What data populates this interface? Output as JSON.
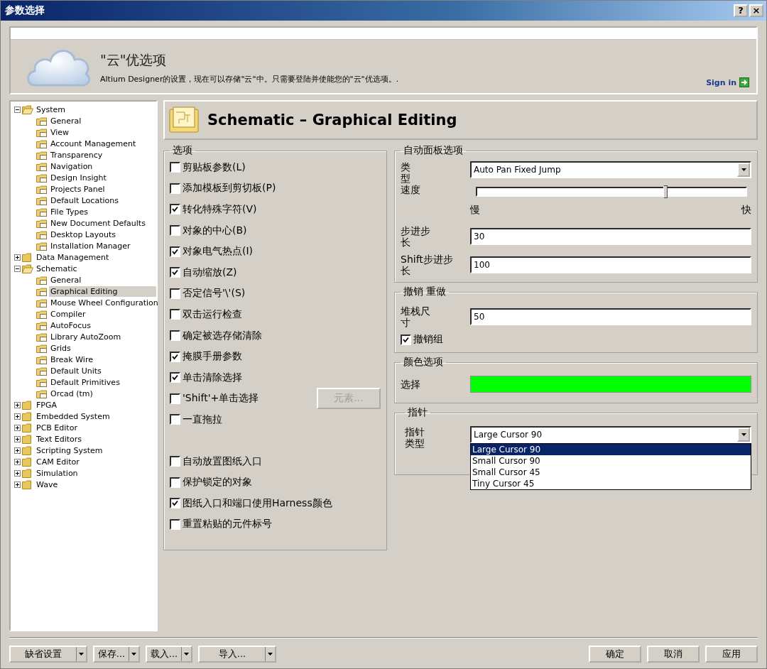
{
  "window": {
    "title": "参数选择",
    "help_button": "?",
    "close_button": "×"
  },
  "banner": {
    "heading": "\"云\"优选项",
    "description": "Altium Designer的设置，现在可以存储\"云\"中。只需要登陆并使能您的\"云\"优选项。.",
    "sign_in": "Sign in"
  },
  "tree": [
    {
      "label": "System",
      "expanded": true,
      "selected": false,
      "children": [
        {
          "label": "General",
          "selected": false
        },
        {
          "label": "View",
          "selected": false
        },
        {
          "label": "Account Management",
          "selected": false
        },
        {
          "label": "Transparency",
          "selected": false
        },
        {
          "label": "Navigation",
          "selected": false
        },
        {
          "label": "Design Insight",
          "selected": false
        },
        {
          "label": "Projects Panel",
          "selected": false
        },
        {
          "label": "Default Locations",
          "selected": false
        },
        {
          "label": "File Types",
          "selected": false
        },
        {
          "label": "New Document Defaults",
          "selected": false
        },
        {
          "label": "Desktop Layouts",
          "selected": false
        },
        {
          "label": "Installation Manager",
          "selected": false
        }
      ]
    },
    {
      "label": "Data Management",
      "expanded": false,
      "selected": false
    },
    {
      "label": "Schematic",
      "expanded": true,
      "selected": false,
      "children": [
        {
          "label": "General",
          "selected": false
        },
        {
          "label": "Graphical Editing",
          "selected": true
        },
        {
          "label": "Mouse Wheel Configuration",
          "selected": false
        },
        {
          "label": "Compiler",
          "selected": false
        },
        {
          "label": "AutoFocus",
          "selected": false
        },
        {
          "label": "Library AutoZoom",
          "selected": false
        },
        {
          "label": "Grids",
          "selected": false
        },
        {
          "label": "Break Wire",
          "selected": false
        },
        {
          "label": "Default Units",
          "selected": false
        },
        {
          "label": "Default Primitives",
          "selected": false
        },
        {
          "label": "Orcad (tm)",
          "selected": false
        }
      ]
    },
    {
      "label": "FPGA",
      "expanded": false,
      "selected": false
    },
    {
      "label": "Embedded System",
      "expanded": false,
      "selected": false
    },
    {
      "label": "PCB Editor",
      "expanded": false,
      "selected": false
    },
    {
      "label": "Text Editors",
      "expanded": false,
      "selected": false
    },
    {
      "label": "Scripting System",
      "expanded": false,
      "selected": false
    },
    {
      "label": "CAM Editor",
      "expanded": false,
      "selected": false
    },
    {
      "label": "Simulation",
      "expanded": false,
      "selected": false
    },
    {
      "label": "Wave",
      "expanded": false,
      "selected": false
    }
  ],
  "page": {
    "title": "Schematic – Graphical Editing"
  },
  "options": {
    "title": "选项",
    "items": [
      {
        "label": "剪贴板参数(L)",
        "checked": false
      },
      {
        "label": "添加模板到剪切板(P)",
        "checked": false
      },
      {
        "label": "转化特殊字符(V)",
        "checked": true
      },
      {
        "label": "对象的中心(B)",
        "checked": false
      },
      {
        "label": "对象电气热点(I)",
        "checked": true
      },
      {
        "label": "自动缩放(Z)",
        "checked": true
      },
      {
        "label": "否定信号'\\'(S)",
        "checked": false
      },
      {
        "label": "双击运行检查",
        "checked": false
      },
      {
        "label": "确定被选存储清除",
        "checked": false
      },
      {
        "label": "掩膜手册参数",
        "checked": true
      },
      {
        "label": "单击清除选择",
        "checked": true
      },
      {
        "label": "'Shift'+单击选择",
        "checked": false,
        "button": {
          "label": "元素...",
          "disabled": true
        }
      },
      {
        "label": "一直拖拉",
        "checked": false
      }
    ],
    "items_2": [
      {
        "label": "自动放置图纸入口",
        "checked": false
      },
      {
        "label": "保护锁定的对象",
        "checked": false
      },
      {
        "label": "图纸入口和端口使用Harness颜色",
        "checked": true
      },
      {
        "label": "重置粘贴的元件标号",
        "checked": false
      }
    ]
  },
  "auto_pan": {
    "title": "自动面板选项",
    "type_label": "类型",
    "type_value": "Auto Pan Fixed Jump",
    "speed_label": "速度",
    "speed": {
      "level": 0.7
    },
    "slow_label": "慢",
    "fast_label": "快",
    "step_label": "步进步长",
    "step_value": "30",
    "shift_step_label": "Shift步进步长",
    "shift_step_value": "100"
  },
  "undo": {
    "title": "撤销 重做",
    "stack_label": "堆栈尺寸",
    "stack_value": "50",
    "group_label": "撤销组",
    "group_checked": true
  },
  "color_options": {
    "title": "颜色选项",
    "label": "选择",
    "color": "#00ff00"
  },
  "cursor": {
    "title": "指针",
    "label": "指针类型",
    "value": "Large Cursor 90",
    "expanded": true,
    "options": [
      {
        "label": "Large Cursor 90",
        "selected": true
      },
      {
        "label": "Small Cursor 90",
        "selected": false
      },
      {
        "label": "Small Cursor 45",
        "selected": false
      },
      {
        "label": "Tiny Cursor 45",
        "selected": false
      }
    ]
  },
  "footer": {
    "left_buttons": [
      "缺省设置",
      "保存...",
      "载入...",
      "导入..."
    ],
    "right_buttons": [
      "确定",
      "取消",
      "应用"
    ]
  }
}
